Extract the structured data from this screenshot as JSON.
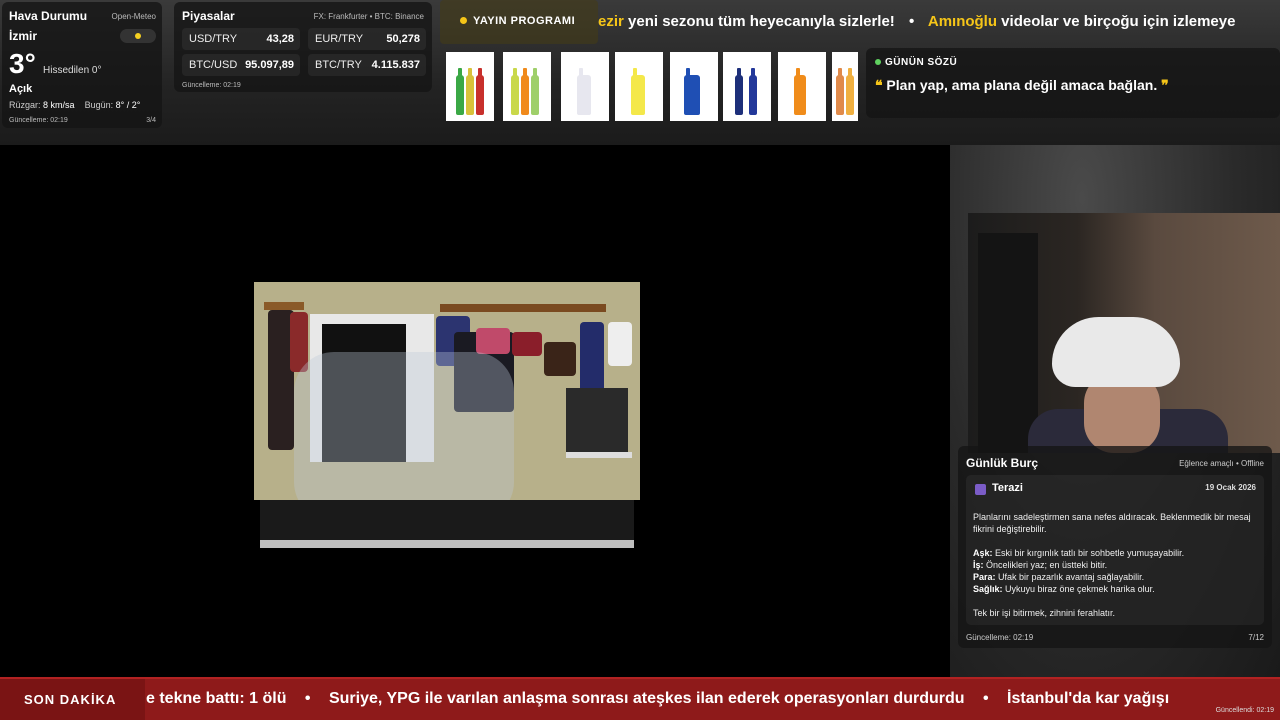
{
  "weather": {
    "title": "Hava Durumu",
    "source": "Open-Meteo",
    "city": "İzmir",
    "temperature": "3°",
    "feels_like": "Hissedilen 0°",
    "condition": "Açık",
    "wind_label": "Rüzgar:",
    "wind_value": "8 km/sa",
    "today_label": "Bugün:",
    "today_value": "8° / 2°",
    "updated": "Güncelleme: 02:19",
    "page": "3/4"
  },
  "markets": {
    "title": "Piyasalar",
    "source": "FX: Frankfurter • BTC: Binance",
    "items": [
      {
        "pair": "USD/TRY",
        "value": "43,28"
      },
      {
        "pair": "EUR/TRY",
        "value": "50,278"
      },
      {
        "pair": "BTC/USD",
        "value": "95.097,89"
      },
      {
        "pair": "BTC/TRY",
        "value": "4.115.837"
      }
    ],
    "updated": "Güncelleme: 02:19"
  },
  "schedule": {
    "label": "YAYIN PROGRAMI"
  },
  "top_ticker": {
    "part1_highlight": "ezir",
    "part1_rest": " yeni sezonu tüm heyecanıyla sizlerle!",
    "separator": "•",
    "part2_highlight": "Amınoğlu",
    "part2_rest": " videolar ve birçoğu için izlemeye"
  },
  "quote": {
    "title": "GÜNÜN SÖZÜ",
    "open": "❝",
    "text": " Plan yap, ama plana değil amaca bağlan. ",
    "close": "❞"
  },
  "horoscope": {
    "title": "Günlük Burç",
    "status": "Eğlence amaçlı • Offline",
    "sign": "Terazi",
    "date": "19 Ocak 2026",
    "summary": "Planlarını sadeleştirmen sana nefes aldıracak. Beklenmedik bir mesaj fikrini değiştirebilir.",
    "love_label": "Aşk:",
    "love": " Eski bir kırgınlık tatlı bir sohbetle yumuşayabilir.",
    "work_label": "İş:",
    "work": " Öncelikleri yaz; en üstteki bitir.",
    "money_label": "Para:",
    "money": " Ufak bir pazarlık avantaj sağlayabilir.",
    "health_label": "Sağlık:",
    "health": " Uykuyu biraz öne çekmek harika olur.",
    "advice": "Tek bir işi bitirmek, zihnini ferahlatır.",
    "updated": "Güncelleme: 02:19",
    "page": "7/12"
  },
  "breaking": {
    "label": "SON DAKİKA",
    "item1": "e tekne battı: 1 ölü",
    "separator": "•",
    "item2": "Suriye, YPG ile varılan anlaşma sonrası ateşkes ilan ederek operasyonları durdurdu",
    "item3": "İstanbul'da kar yağışı",
    "updated": "Güncellendi: 02:19"
  },
  "colors": {
    "accent": "#f5c518",
    "breaking_bg": "#8e1a1a",
    "quote_dot": "#5fd15f"
  }
}
